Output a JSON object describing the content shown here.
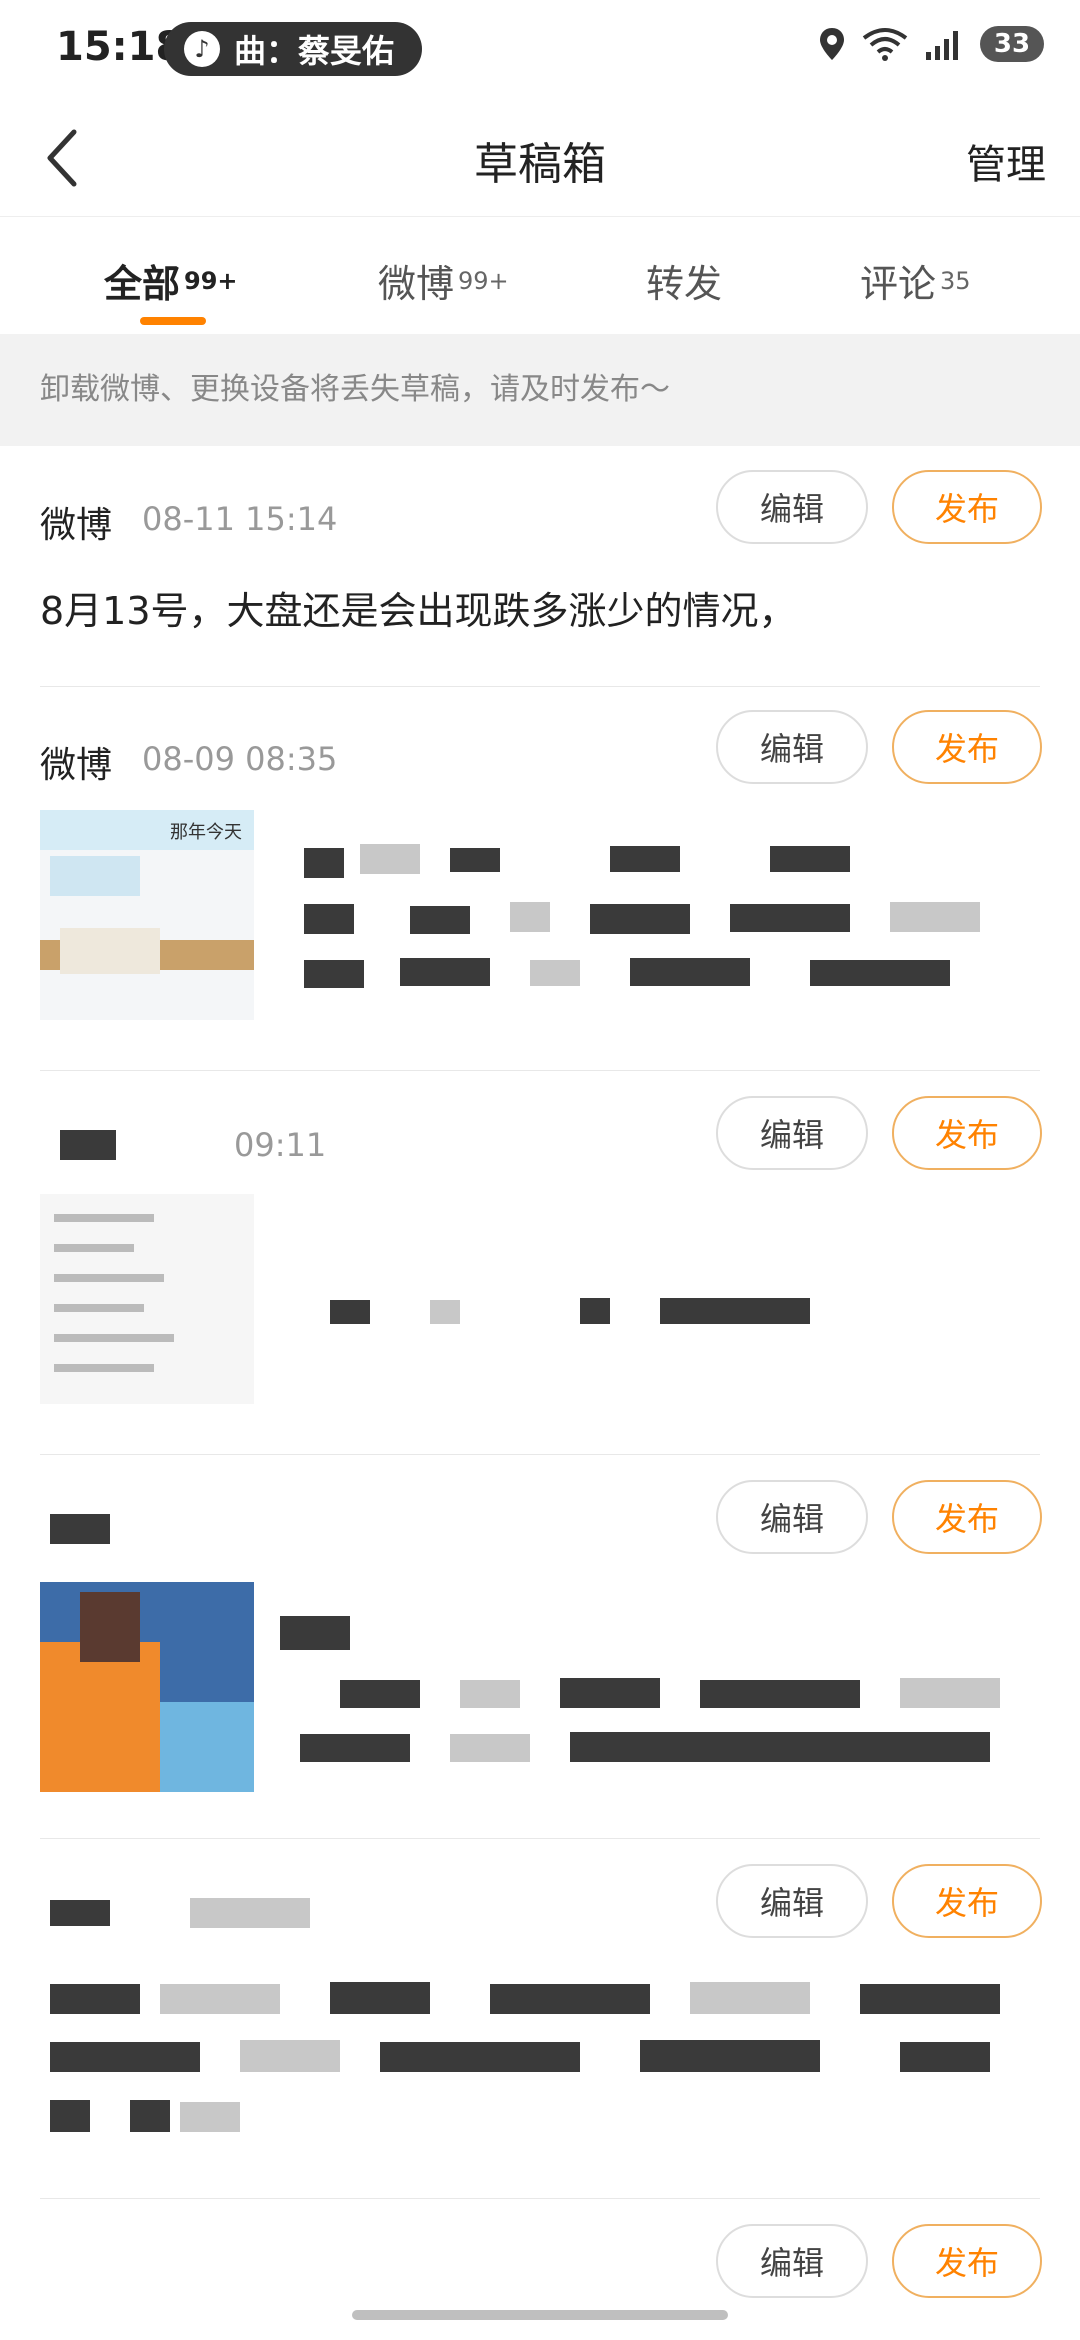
{
  "status_bar": {
    "time": "15:18",
    "music": "曲：蔡旻佑",
    "battery": "33"
  },
  "header": {
    "title": "草稿箱",
    "manage": "管理"
  },
  "tabs": [
    {
      "label": "全部",
      "count": "99+",
      "active": true
    },
    {
      "label": "微博",
      "count": "99+"
    },
    {
      "label": "转发",
      "count": ""
    },
    {
      "label": "评论",
      "count": "35"
    }
  ],
  "notice": "卸载微博、更换设备将丢失草稿，请及时发布～",
  "buttons": {
    "edit": "编辑",
    "publish": "发布"
  },
  "drafts": [
    {
      "kind": "微博",
      "time": "08-11 15:14",
      "text": "8月13号，大盘还是会出现跌多涨少的情况，"
    },
    {
      "kind": "微博",
      "time": "08-09 08:35",
      "text": ""
    },
    {
      "kind": "",
      "time": "09:11",
      "text": ""
    },
    {
      "kind": "",
      "time": "",
      "text": ""
    },
    {
      "kind": "",
      "time": "",
      "text": ""
    },
    {
      "kind": "",
      "time": "",
      "text": ""
    }
  ],
  "thumb2_caption": "那年今天",
  "colors": {
    "accent": "#ff8200",
    "publish_border": "#f0b060"
  }
}
